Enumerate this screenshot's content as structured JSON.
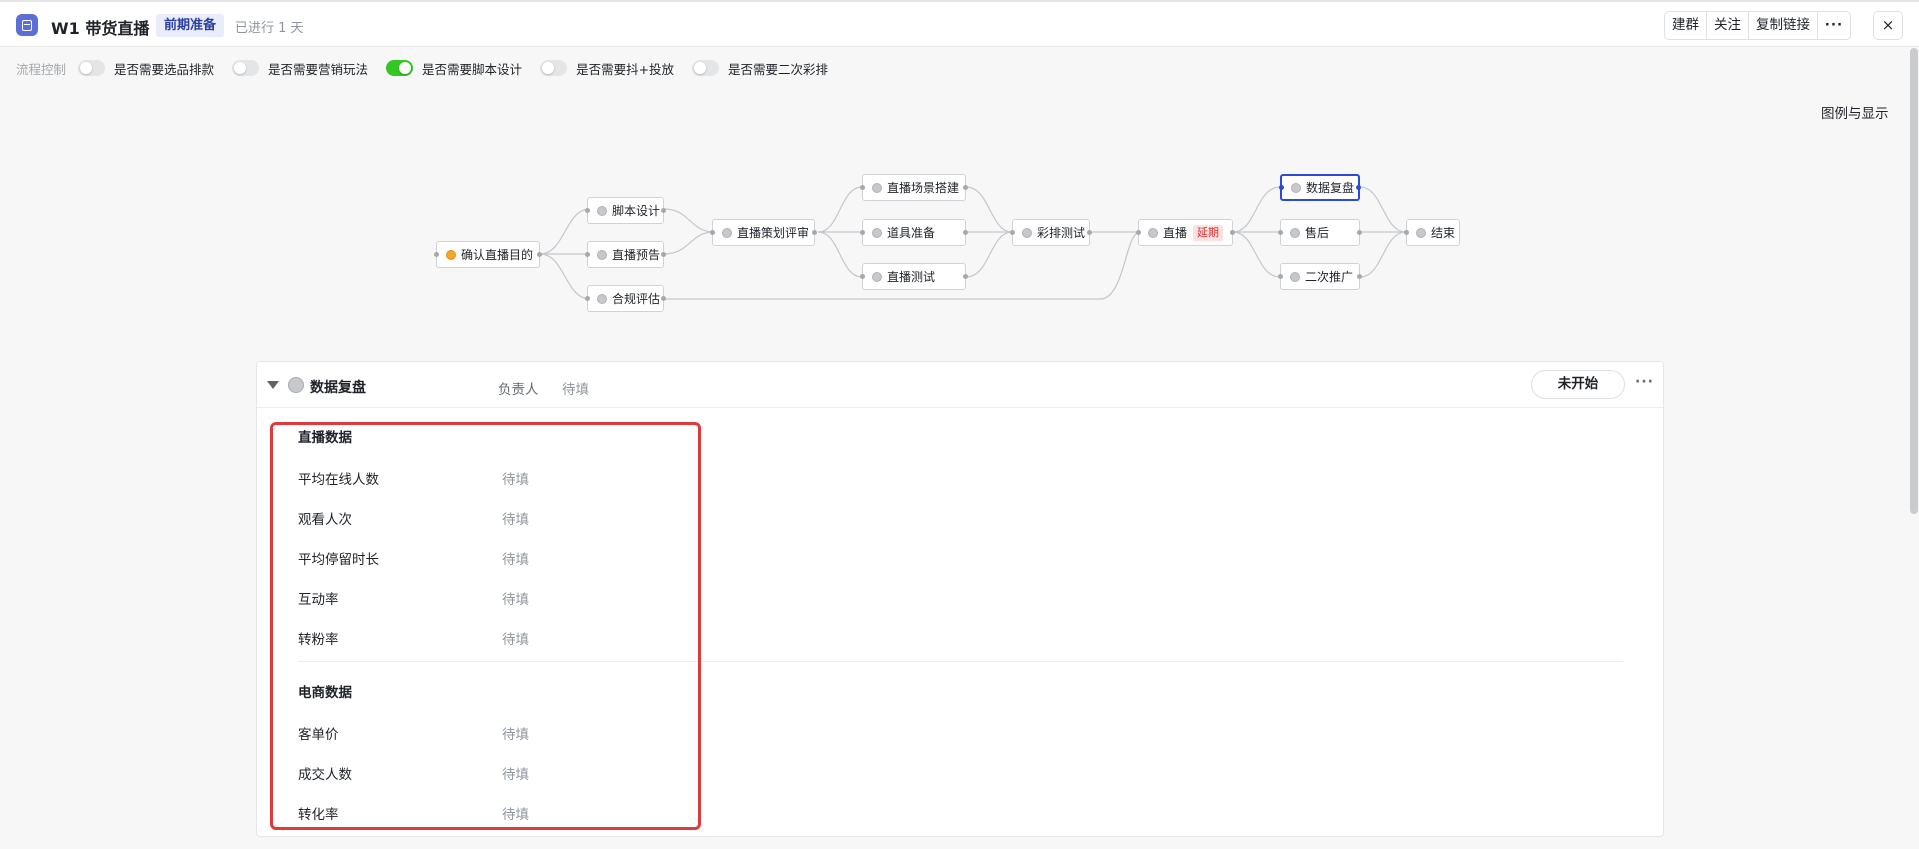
{
  "header": {
    "title": "W1 带货直播",
    "phase": "前期准备",
    "elapsed": "已进行 1 天",
    "actions": [
      "建群",
      "关注",
      "复制链接",
      "···"
    ],
    "close": "×"
  },
  "process_control": {
    "label": "流程控制",
    "toggles": [
      {
        "label": "是否需要选品排款",
        "on": false
      },
      {
        "label": "是否需要营销玩法",
        "on": false
      },
      {
        "label": "是否需要脚本设计",
        "on": true
      },
      {
        "label": "是否需要抖+投放",
        "on": false
      },
      {
        "label": "是否需要二次彩排",
        "on": false
      }
    ]
  },
  "legend_link": "图例与显示",
  "flow_nodes": {
    "confirm_goal": "确认直播目的",
    "script_design": "脚本设计",
    "live_preview": "直播预告",
    "compliance": "合规评估",
    "plan_review": "直播策划评审",
    "scene_build": "直播场景搭建",
    "props_prep": "道具准备",
    "live_test": "直播测试",
    "rehearsal": "彩排测试",
    "live": "直播",
    "live_tag": "延期",
    "data_review": "数据复盘",
    "after_sales": "售后",
    "promotion": "二次推广",
    "end": "结束"
  },
  "panel": {
    "title": "数据复盘",
    "owner_label": "负责人",
    "owner_value": "待填",
    "status": "未开始",
    "more": "···",
    "sections": [
      {
        "title": "直播数据",
        "rows": [
          {
            "label": "平均在线人数",
            "value": "待填"
          },
          {
            "label": "观看人次",
            "value": "待填"
          },
          {
            "label": "平均停留时长",
            "value": "待填"
          },
          {
            "label": "互动率",
            "value": "待填"
          },
          {
            "label": "转粉率",
            "value": "待填"
          }
        ]
      },
      {
        "title": "电商数据",
        "rows": [
          {
            "label": "客单价",
            "value": "待填"
          },
          {
            "label": "成交人数",
            "value": "待填"
          },
          {
            "label": "转化率",
            "value": "待填"
          }
        ]
      }
    ]
  },
  "colors": {
    "accent": "#2b4bd8",
    "toggle_on": "#34c724",
    "highlight": "#e0393e",
    "delay_tag": "#d43030"
  }
}
